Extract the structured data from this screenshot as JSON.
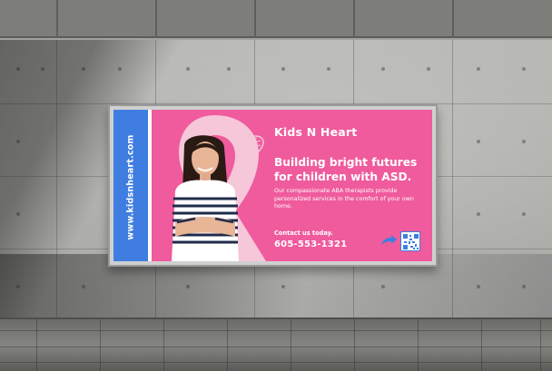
{
  "billboard": {
    "website": "www.kidsnheart.com",
    "brand": "Kids N Heart",
    "headline_line1": "Building bright futures",
    "headline_line2": "for children with ASD.",
    "body": "Our compassionate ABA therapists provide personalized services in the comfort of your own home.",
    "contact_label": "Contact us today.",
    "phone": "605-553-1321"
  },
  "icons": {
    "logo": "heart-icon",
    "ribbon": "awareness-ribbon-icon",
    "arrow": "curved-arrow-icon",
    "qr": "qr-code-icon"
  },
  "colors": {
    "board_pink": "#ef5b9c",
    "side_blue": "#3f7ee0",
    "ribbon_light": "#f6c6d9",
    "text": "#ffffff"
  }
}
